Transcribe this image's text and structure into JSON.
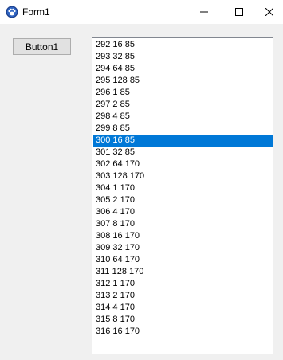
{
  "window": {
    "title": "Form1"
  },
  "button1": {
    "label": "Button1"
  },
  "listbox": {
    "selected_index": 8,
    "items": [
      "292 16 85",
      "293 32 85",
      "294 64 85",
      "295 128 85",
      "296 1 85",
      "297 2 85",
      "298 4 85",
      "299 8 85",
      "300 16 85",
      "301 32 85",
      "302 64 170",
      "303 128 170",
      "304 1 170",
      "305 2 170",
      "306 4 170",
      "307 8 170",
      "308 16 170",
      "309 32 170",
      "310 64 170",
      "311 128 170",
      "312 1 170",
      "313 2 170",
      "314 4 170",
      "315 8 170",
      "316 16 170"
    ]
  },
  "colors": {
    "selection": "#0078d7",
    "selection_text": "#ffffff"
  }
}
